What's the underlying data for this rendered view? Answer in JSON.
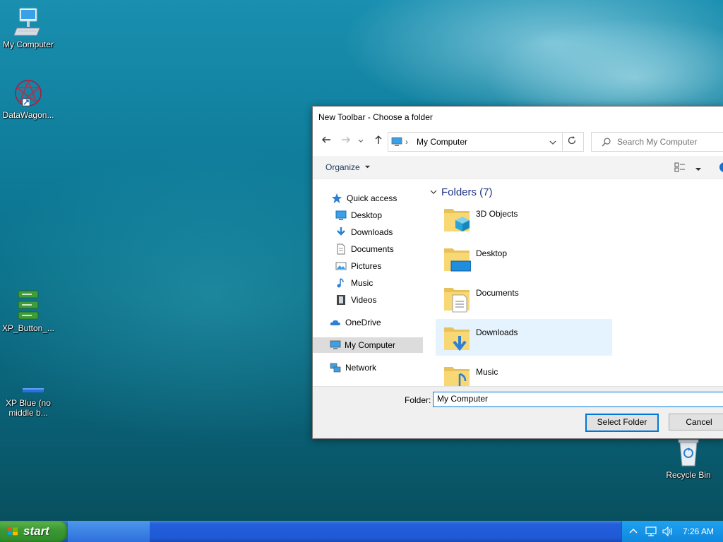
{
  "desktop": {
    "icons": [
      {
        "label": "My Computer",
        "icon": "computer-icon"
      },
      {
        "label": "DataWagon...",
        "icon": "datawagon-icon"
      },
      {
        "label": "XP_Button_...",
        "icon": "xp-button-icon"
      },
      {
        "label": "XP Blue (no middle b...",
        "label_line1": "XP Blue (no",
        "label_line2": "middle b...",
        "icon": "xp-blue-icon"
      },
      {
        "label": "Recycle Bin",
        "icon": "recycle-bin-icon"
      }
    ]
  },
  "dialog": {
    "title": "New Toolbar - Choose a folder",
    "address": "My Computer",
    "search_placeholder": "Search My Computer",
    "organize_label": "Organize",
    "nav": {
      "quick_access": "Quick access",
      "items": [
        {
          "label": "Desktop",
          "pinned": true,
          "icon": "desktop-icon"
        },
        {
          "label": "Downloads",
          "pinned": true,
          "icon": "download-icon"
        },
        {
          "label": "Documents",
          "pinned": true,
          "icon": "document-icon"
        },
        {
          "label": "Pictures",
          "pinned": true,
          "icon": "picture-icon"
        },
        {
          "label": "Music",
          "pinned": false,
          "icon": "music-icon"
        },
        {
          "label": "Videos",
          "pinned": false,
          "icon": "video-icon"
        }
      ],
      "onedrive": "OneDrive",
      "my_computer": "My Computer",
      "network": "Network"
    },
    "content": {
      "group_header": "Folders (7)",
      "folders": [
        {
          "name": "3D Objects",
          "icon": "3d-objects-folder-icon"
        },
        {
          "name": "Desktop",
          "icon": "desktop-folder-icon"
        },
        {
          "name": "Documents",
          "icon": "documents-folder-icon"
        },
        {
          "name": "Downloads",
          "icon": "downloads-folder-icon",
          "selected": true
        },
        {
          "name": "Music",
          "icon": "music-folder-icon"
        }
      ]
    },
    "folder_label": "Folder:",
    "folder_value": "My Computer",
    "select_button": "Select Folder",
    "cancel_button": "Cancel"
  },
  "taskbar": {
    "start_label": "start",
    "clock": "7:26 AM"
  },
  "colors": {
    "taskbar_blue": "#245edb",
    "start_green": "#3c9a35",
    "selection": "#e5f3ff",
    "accent": "#0078d7"
  }
}
